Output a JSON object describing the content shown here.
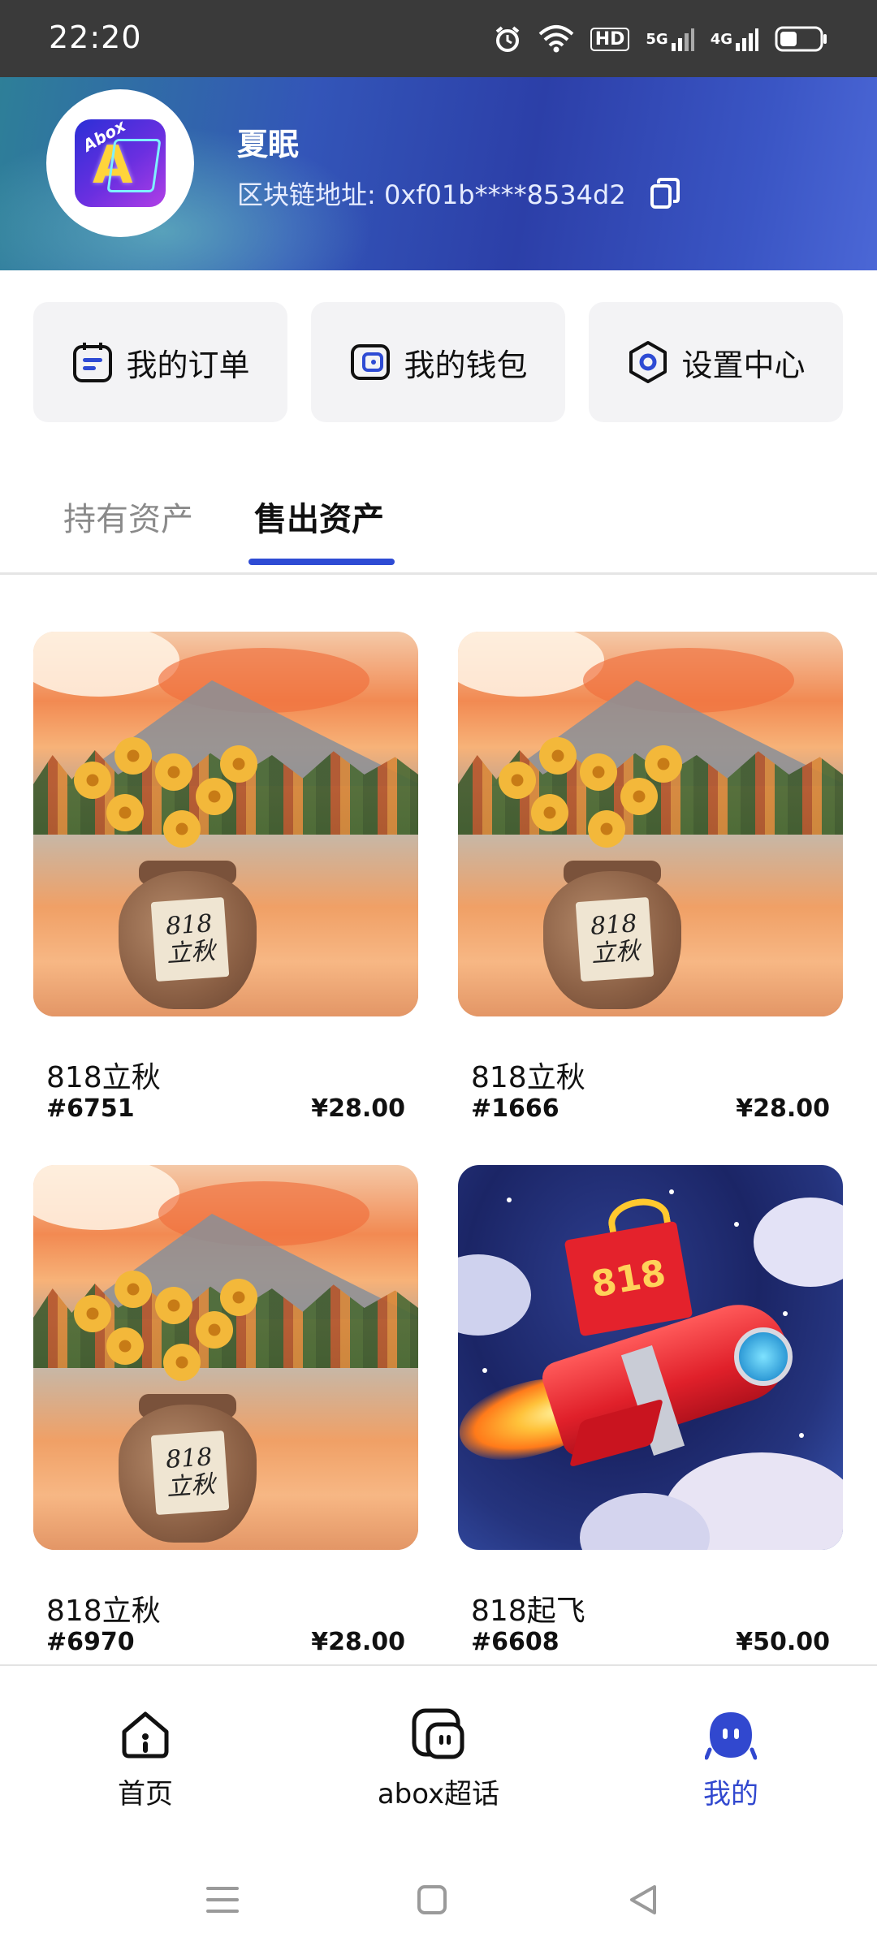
{
  "status_bar": {
    "time": "22:20",
    "hd_label": "HD",
    "net1": "5G",
    "net2": "4G"
  },
  "profile": {
    "name": "夏眠",
    "address_label": "区块链地址:",
    "address_value": "0xf01b****8534d2",
    "avatar_text": "Abox",
    "avatar_mark": "A"
  },
  "quick_actions": [
    {
      "label": "我的订单",
      "icon": "order-icon"
    },
    {
      "label": "我的钱包",
      "icon": "wallet-icon"
    },
    {
      "label": "设置中心",
      "icon": "settings-icon"
    }
  ],
  "tabs": [
    {
      "label": "持有资产",
      "active": false
    },
    {
      "label": "售出资产",
      "active": true
    }
  ],
  "assets": [
    {
      "title": "818立秋",
      "serial": "#6751",
      "price": "¥28.00",
      "art": "autumn",
      "art_text_1": "818",
      "art_text_2": "立秋"
    },
    {
      "title": "818立秋",
      "serial": "#1666",
      "price": "¥28.00",
      "art": "autumn",
      "art_text_1": "818",
      "art_text_2": "立秋"
    },
    {
      "title": "818立秋",
      "serial": "#6970",
      "price": "¥28.00",
      "art": "autumn",
      "art_text_1": "818",
      "art_text_2": "立秋"
    },
    {
      "title": "818起飞",
      "serial": "#6608",
      "price": "¥50.00",
      "art": "rocket",
      "art_text_1": "818"
    }
  ],
  "bottom_nav": [
    {
      "label": "首页",
      "icon": "home-icon",
      "active": false
    },
    {
      "label": "abox超话",
      "icon": "chat-icon",
      "active": false
    },
    {
      "label": "我的",
      "icon": "profile-icon",
      "active": true
    }
  ],
  "colors": {
    "accent": "#2e4bd4",
    "active_nav": "#3148cf"
  }
}
